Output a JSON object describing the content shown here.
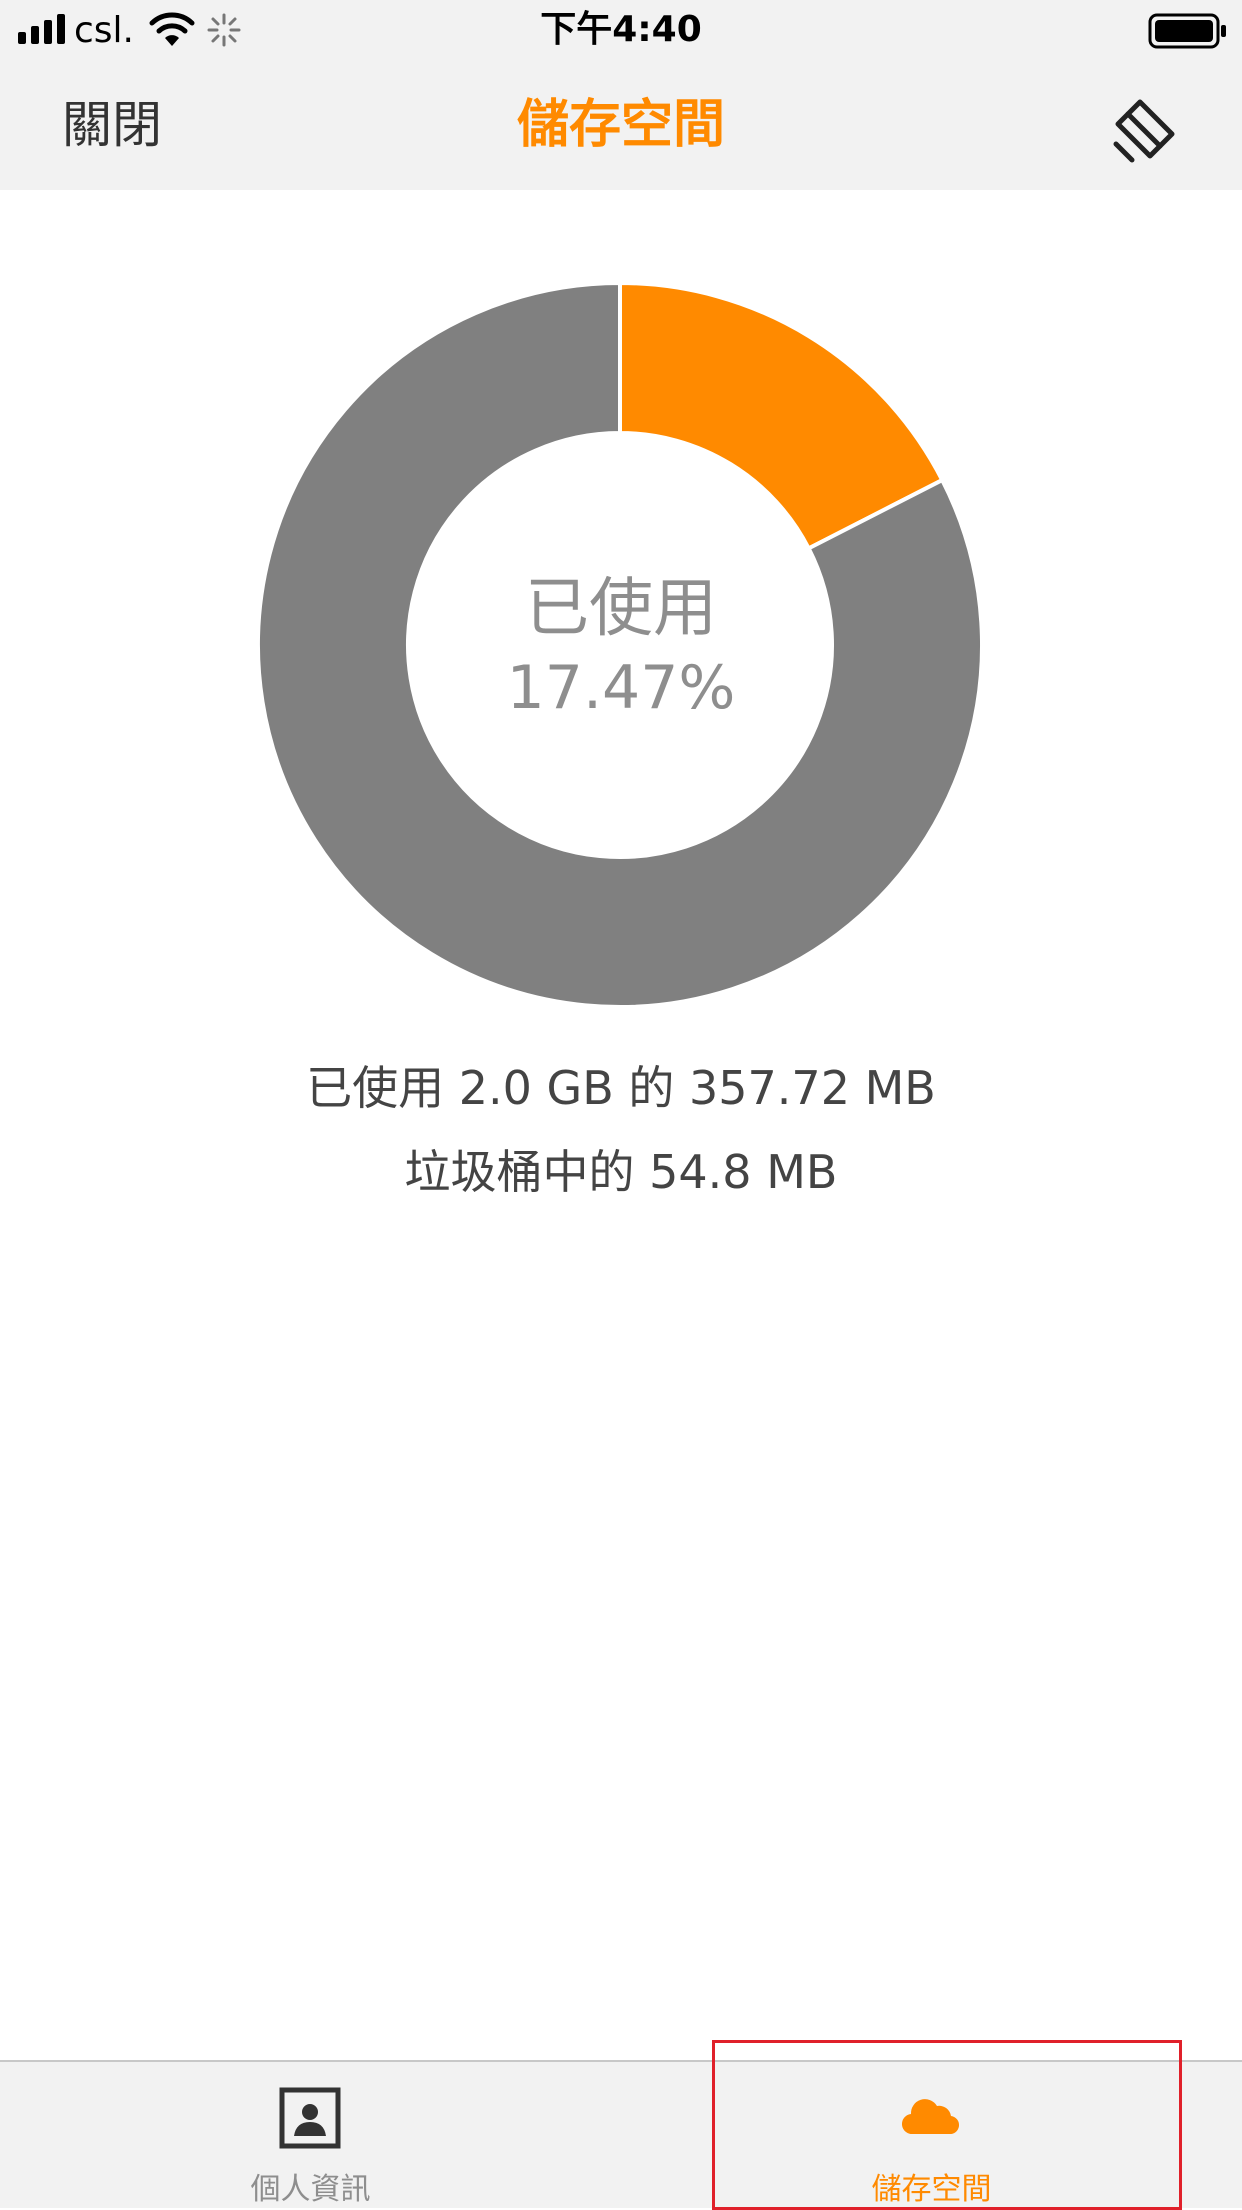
{
  "status_bar": {
    "carrier": "csl.",
    "time": "下午4:40",
    "icons": [
      "signal-bars-icon",
      "wifi-icon",
      "activity-spinner-icon",
      "battery-icon"
    ]
  },
  "nav": {
    "close_label": "關閉",
    "title": "儲存空間",
    "action_icon": "eraser-icon"
  },
  "storage": {
    "used_label": "已使用",
    "used_percent": "17.47%",
    "usage_text": "已使用 2.0 GB 的 357.72 MB",
    "trash_text": "垃圾桶中的 54.8 MB"
  },
  "chart_data": {
    "type": "pie",
    "categories": [
      "used",
      "free"
    ],
    "values": [
      17.47,
      82.53
    ],
    "colors": [
      "#ff8a00",
      "#808080"
    ],
    "donut": true
  },
  "tabs": [
    {
      "label": "個人資訊",
      "icon": "profile-icon",
      "selected": false
    },
    {
      "label": "儲存空間",
      "icon": "cloud-icon",
      "selected": true
    }
  ],
  "colors": {
    "accent": "#ff8a00",
    "inactive": "#8e8e8e",
    "bar_bg": "#f2f2f2",
    "highlight": "#e0202a"
  }
}
